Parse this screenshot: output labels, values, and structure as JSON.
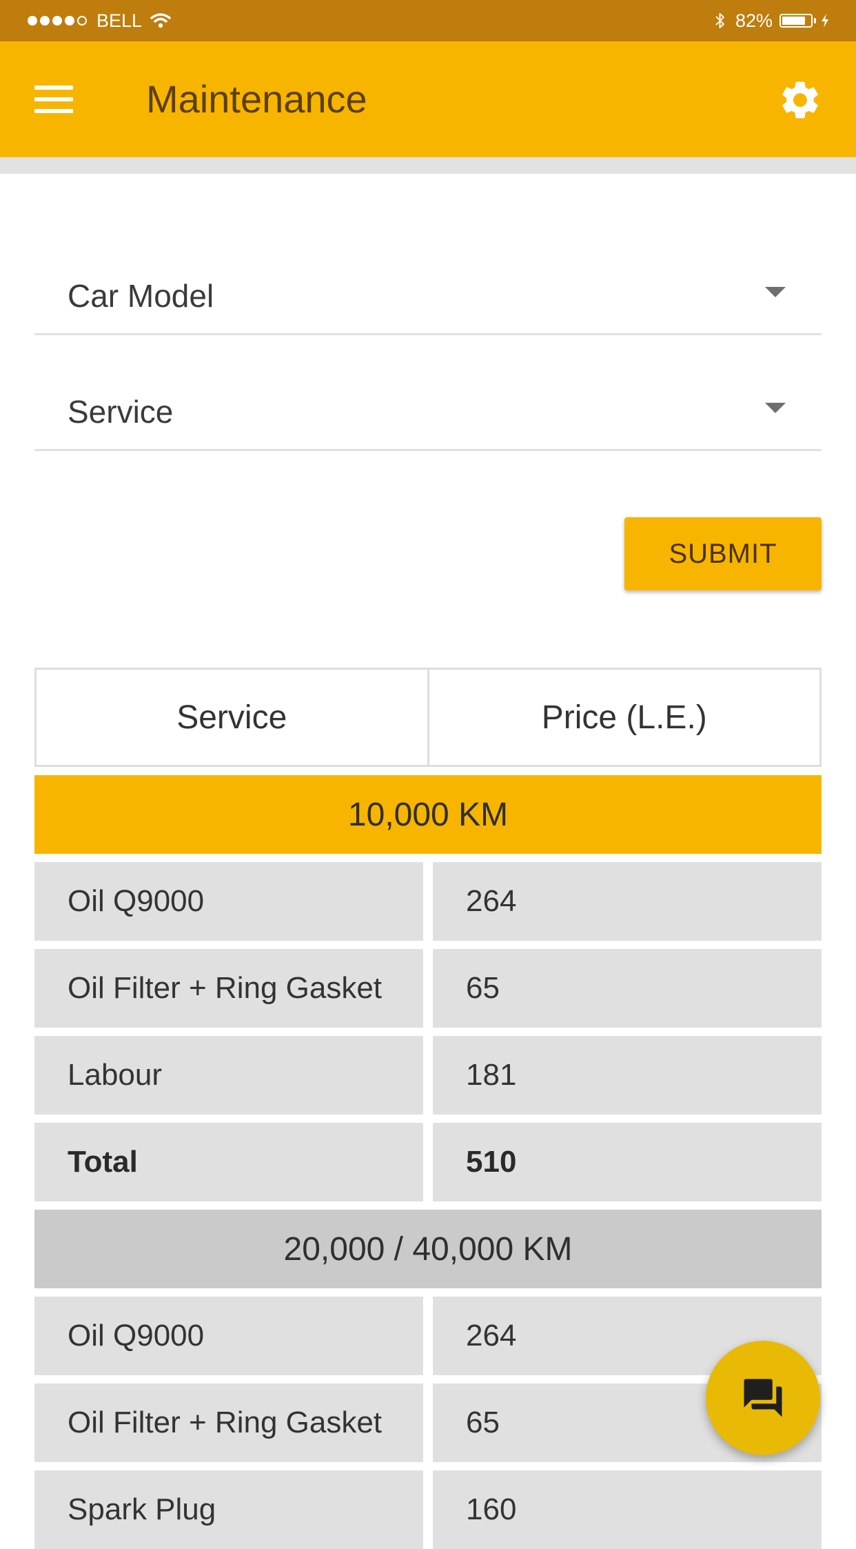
{
  "status_bar": {
    "carrier": "BELL",
    "battery_percent": "82%",
    "signal_bars_filled": 4,
    "signal_bars_total": 5,
    "battery_level": 0.82,
    "icons": [
      "signal-dots-icon",
      "wifi-icon",
      "bluetooth-icon",
      "battery-icon",
      "charging-bolt-icon"
    ]
  },
  "app_bar": {
    "title": "Maintenance",
    "menu_icon": "hamburger-menu-icon",
    "settings_icon": "gear-icon"
  },
  "form": {
    "car_model_placeholder": "Car Model",
    "service_placeholder": "Service",
    "submit_label": "SUBMIT"
  },
  "table": {
    "headers": [
      "Service",
      "Price (L.E.)"
    ],
    "sections": [
      {
        "title": "10,000 KM",
        "rows": [
          {
            "service": "Oil Q9000",
            "price": "264"
          },
          {
            "service": "Oil Filter + Ring Gasket",
            "price": "65"
          },
          {
            "service": "Labour",
            "price": "181"
          },
          {
            "service": "Total",
            "price": "510"
          }
        ]
      },
      {
        "title": "20,000 / 40,000 KM",
        "rows": [
          {
            "service": "Oil Q9000",
            "price": "264"
          },
          {
            "service": "Oil Filter + Ring Gasket",
            "price": "65"
          },
          {
            "service": "Spark Plug",
            "price": "160"
          }
        ]
      }
    ]
  },
  "fab": {
    "icon": "chat-forum-icon"
  },
  "colors": {
    "status_bar": "#BE7D0C",
    "primary": "#F7B500",
    "fab": "#E8BA06",
    "title_text": "#5B3F02",
    "cell_background": "#E0E0E0",
    "section_alt": "#CACACA"
  }
}
